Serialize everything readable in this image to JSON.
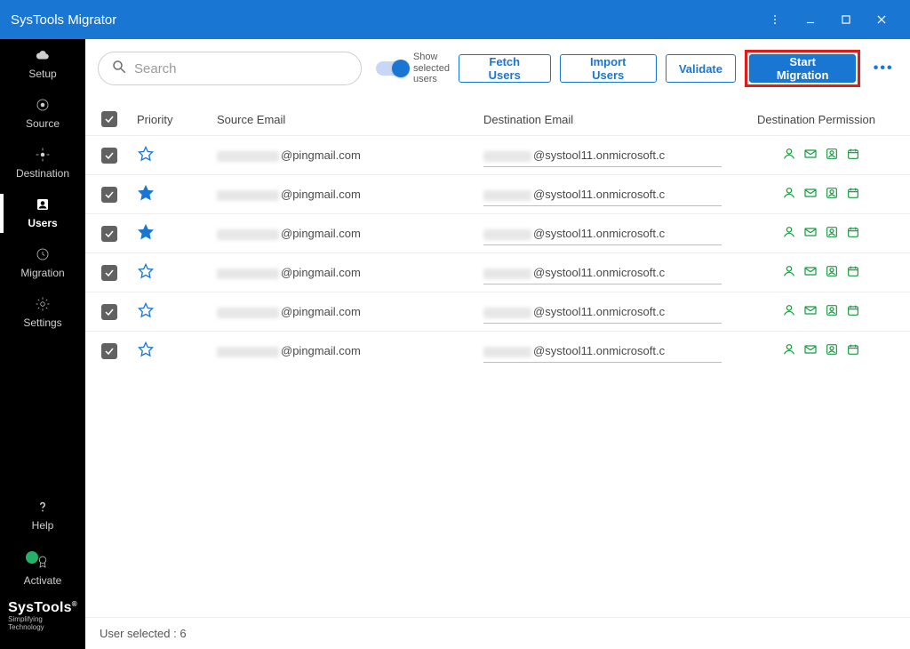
{
  "titlebar": {
    "title": "SysTools Migrator"
  },
  "sidebar": {
    "items": [
      {
        "key": "setup",
        "label": "Setup"
      },
      {
        "key": "source",
        "label": "Source"
      },
      {
        "key": "destination",
        "label": "Destination"
      },
      {
        "key": "users",
        "label": "Users"
      },
      {
        "key": "migration",
        "label": "Migration"
      },
      {
        "key": "settings",
        "label": "Settings"
      }
    ],
    "bottom": [
      {
        "key": "help",
        "label": "Help"
      },
      {
        "key": "activate",
        "label": "Activate"
      }
    ],
    "brand_line1": "SysTools",
    "brand_line2": "Simplifying Technology",
    "brand_reg": "®"
  },
  "toolbar": {
    "search_placeholder": "Search",
    "toggle_line1": "Show",
    "toggle_line2": "selected",
    "toggle_line3": "users",
    "fetch_label": "Fetch Users",
    "import_label": "Import Users",
    "validate_label": "Validate",
    "start_label": "Start Migration"
  },
  "table": {
    "headers": {
      "priority": "Priority",
      "source": "Source Email",
      "destination": "Destination Email",
      "permission": "Destination Permission"
    },
    "rows": [
      {
        "checked": true,
        "starred": false,
        "src_domain": "@pingmail.com",
        "dst_domain": "@systool11.onmicrosoft.c"
      },
      {
        "checked": true,
        "starred": true,
        "src_domain": "@pingmail.com",
        "dst_domain": "@systool11.onmicrosoft.c"
      },
      {
        "checked": true,
        "starred": true,
        "src_domain": "@pingmail.com",
        "dst_domain": "@systool11.onmicrosoft.c"
      },
      {
        "checked": true,
        "starred": false,
        "src_domain": "@pingmail.com",
        "dst_domain": "@systool11.onmicrosoft.c"
      },
      {
        "checked": true,
        "starred": false,
        "src_domain": "@pingmail.com",
        "dst_domain": "@systool11.onmicrosoft.c"
      },
      {
        "checked": true,
        "starred": false,
        "src_domain": "@pingmail.com",
        "dst_domain": "@systool11.onmicrosoft.c"
      }
    ]
  },
  "footer": {
    "status": "User selected : 6"
  }
}
